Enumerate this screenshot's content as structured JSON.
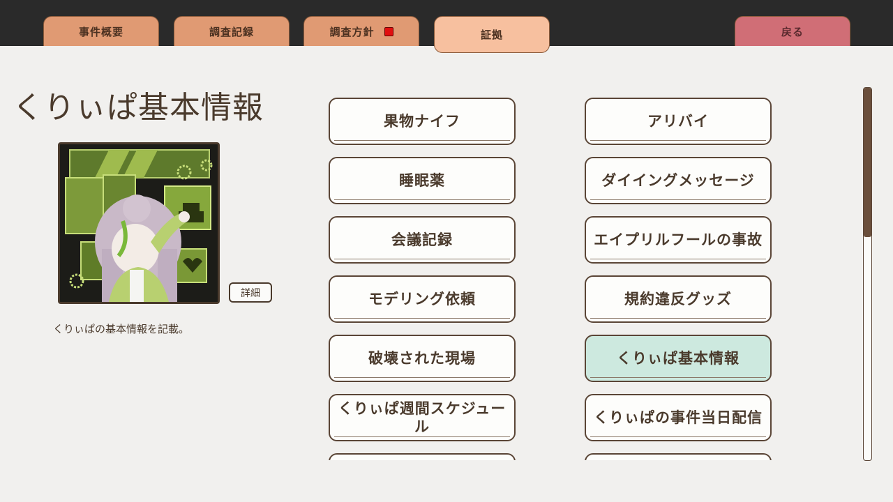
{
  "tabs": [
    {
      "label": "事件概要"
    },
    {
      "label": "調査記録"
    },
    {
      "label": "調査方針",
      "has_notification": true
    },
    {
      "label": "証拠",
      "active": true
    }
  ],
  "back_label": "戻る",
  "info": {
    "title": "くりぃぱ基本情報",
    "detail_label": "詳細",
    "description": "くりぃぱの基本情報を記載。"
  },
  "evidence": [
    {
      "label": "果物ナイフ"
    },
    {
      "label": "アリバイ"
    },
    {
      "label": "睡眠薬"
    },
    {
      "label": "ダイイングメッセージ"
    },
    {
      "label": "会議記録"
    },
    {
      "label": "エイプリルフールの事故"
    },
    {
      "label": "モデリング依頼"
    },
    {
      "label": "規約違反グッズ"
    },
    {
      "label": "破壊された現場"
    },
    {
      "label": "くりぃぱ基本情報",
      "selected": true
    },
    {
      "label": "くりぃぱ週間スケジュール"
    },
    {
      "label": "くりぃぱの事件当日配信"
    },
    {
      "label": ""
    },
    {
      "label": ""
    }
  ],
  "colors": {
    "tab": "#e09a73",
    "tab_active": "#f7c09f",
    "back_button": "#d06e76",
    "selected_item": "#cde9df",
    "notification": "#e01010"
  },
  "scroll_fraction": 0.4
}
